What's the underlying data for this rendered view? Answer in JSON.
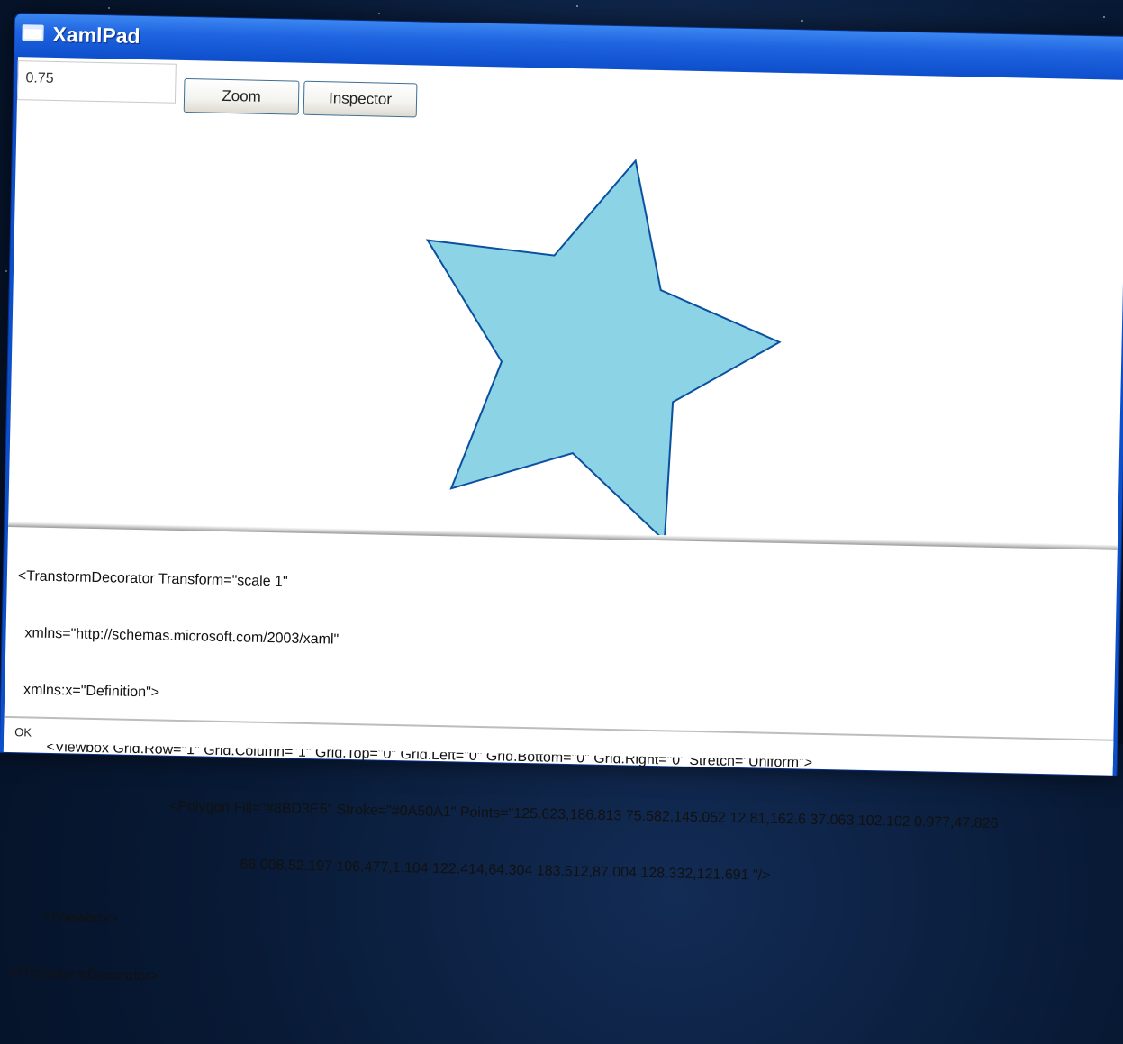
{
  "window": {
    "title": "XamlPad"
  },
  "toolbar": {
    "zoom_value": "0.75",
    "zoom_button": "Zoom",
    "inspector_button": "Inspector"
  },
  "canvas": {
    "shape": "star-polygon",
    "fill": "#8BD3E5",
    "stroke": "#0A50A1"
  },
  "editor": {
    "lines": [
      "<TranstormDecorator Transform=\"scale 1\"",
      "  xmlns=\"http://schemas.microsoft.com/2003/xaml\"",
      "  xmlns:x=\"Definition\">",
      "        <Viewbox Grid.Row=\"1\" Grid.Column=\"1\" Grid.Top=\"0\" Grid.Left=\"0\" Grid.Bottom=\"0\" Grid.Right=\"0\" Stretch=\"Uniform\">",
      "                                       <Polygon Fill=\"#8BD3E5\" Stroke=\"#0A50A1\" Points=\"125.623,186.813 75.582,145.052 12.81,162.6 37.063,102.102 0.977,47.826",
      "                                                         66.008,52.197 106.477,1.104 122.414,64.304 183.512,87.004 128.332,121.691 \"/>",
      "        </Viewbox>",
      "</TransformDecorator>"
    ]
  },
  "status": {
    "text": "OK"
  }
}
